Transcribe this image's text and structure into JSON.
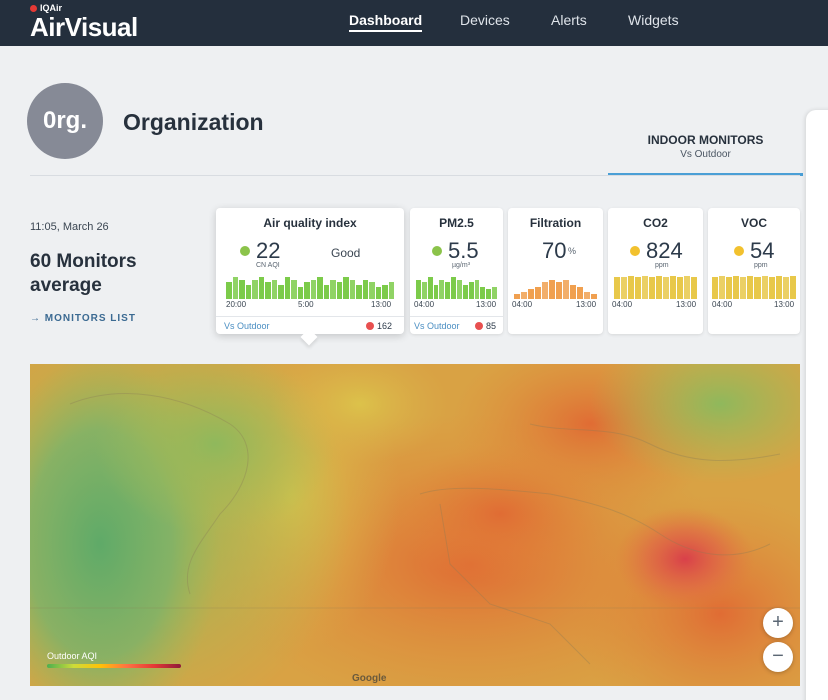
{
  "header": {
    "brand_small": "IQAir",
    "brand": "AirVisual",
    "nav": [
      {
        "label": "Dashboard",
        "active": true
      },
      {
        "label": "Devices"
      },
      {
        "label": "Alerts"
      },
      {
        "label": "Widgets"
      }
    ]
  },
  "org": {
    "avatar": "0rg.",
    "name": "Organization"
  },
  "tab": {
    "title": "INDOOR MONITORS",
    "subtitle": "Vs Outdoor"
  },
  "summary": {
    "time": "11:05, March 26",
    "title": "60 Monitors average",
    "link": "→ MONITORS LIST"
  },
  "cards": {
    "aqi": {
      "title": "Air quality index",
      "value": "22",
      "unit": "CN AQI",
      "status": "Good",
      "dot_color": "#8bc34a",
      "axis": [
        "20:00",
        "5:00",
        "13:00"
      ],
      "bars": [
        0.7,
        0.9,
        0.8,
        0.6,
        0.8,
        0.9,
        0.7,
        0.8,
        0.6,
        0.9,
        0.8,
        0.5,
        0.7,
        0.8,
        0.9,
        0.6,
        0.8,
        0.7,
        0.9,
        0.8,
        0.6,
        0.8,
        0.7,
        0.5,
        0.6,
        0.7
      ],
      "bar_color": "#7ccb4a",
      "vs_label": "Vs Outdoor",
      "vs_value": "162"
    },
    "pm25": {
      "title": "PM2.5",
      "value": "5.5",
      "unit": "µg/m³",
      "dot_color": "#8bc34a",
      "axis": [
        "04:00",
        "13:00"
      ],
      "bars": [
        0.8,
        0.7,
        0.9,
        0.6,
        0.8,
        0.7,
        0.9,
        0.8,
        0.6,
        0.7,
        0.8,
        0.5,
        0.4,
        0.5
      ],
      "bar_color": "#7ccb4a",
      "vs_label": "Vs Outdoor",
      "vs_value": "85"
    },
    "filtration": {
      "title": "Filtration",
      "value": "70",
      "suffix": "%",
      "axis": [
        "04:00",
        "13:00"
      ],
      "bars": [
        0.2,
        0.3,
        0.4,
        0.5,
        0.7,
        0.8,
        0.7,
        0.8,
        0.6,
        0.5,
        0.3,
        0.2
      ],
      "bar_color": "#f0a050"
    },
    "co2": {
      "title": "CO2",
      "value": "824",
      "unit": "ppm",
      "dot_color": "#f2c12e",
      "axis": [
        "04:00",
        "13:00"
      ],
      "bars": [
        0.9,
        0.9,
        0.95,
        0.9,
        0.95,
        0.9,
        0.95,
        0.9,
        0.95,
        0.9,
        0.95,
        0.9
      ],
      "bar_color": "#e8c84a"
    },
    "voc": {
      "title": "VOC",
      "value": "54",
      "unit": "ppm",
      "dot_color": "#f2c12e",
      "axis": [
        "04:00",
        "13:00"
      ],
      "bars": [
        0.9,
        0.95,
        0.9,
        0.95,
        0.9,
        0.95,
        0.9,
        0.95,
        0.9,
        0.95,
        0.9,
        0.95
      ],
      "bar_color": "#e8c84a"
    }
  },
  "map": {
    "legend": "Outdoor AQI",
    "credit": "Google"
  },
  "zoom": {
    "in": "+",
    "out": "−"
  },
  "colors": {
    "nav_bg": "#242f3d",
    "accent": "#4a9fd6",
    "vs_dot": "#e85050"
  }
}
